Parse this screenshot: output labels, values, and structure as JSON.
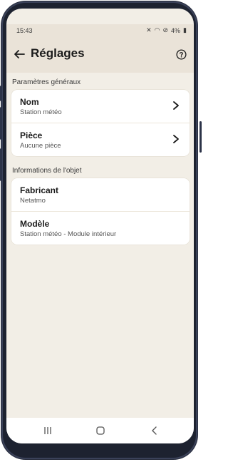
{
  "status_bar": {
    "time": "15:43",
    "battery": "4%"
  },
  "header": {
    "title": "Réglages"
  },
  "sections": [
    {
      "title": "Paramètres généraux",
      "rows": [
        {
          "label": "Nom",
          "value": "Station météo"
        },
        {
          "label": "Pièce",
          "value": "Aucune pièce"
        }
      ]
    },
    {
      "title": "Informations de l'objet",
      "rows": [
        {
          "label": "Fabricant",
          "value": "Netatmo"
        },
        {
          "label": "Modèle",
          "value": "Station météo - Module intérieur"
        }
      ]
    }
  ],
  "icons": {
    "back": "back-arrow-icon",
    "help": "help-icon",
    "chevron": "chevron-right-icon",
    "nav_recents": "recents-icon",
    "nav_home": "home-icon",
    "nav_back": "nav-back-icon"
  },
  "colors": {
    "background": "#f2eee6",
    "header": "#eae3d8",
    "card": "#ffffff",
    "text": "#1b1b1b"
  }
}
